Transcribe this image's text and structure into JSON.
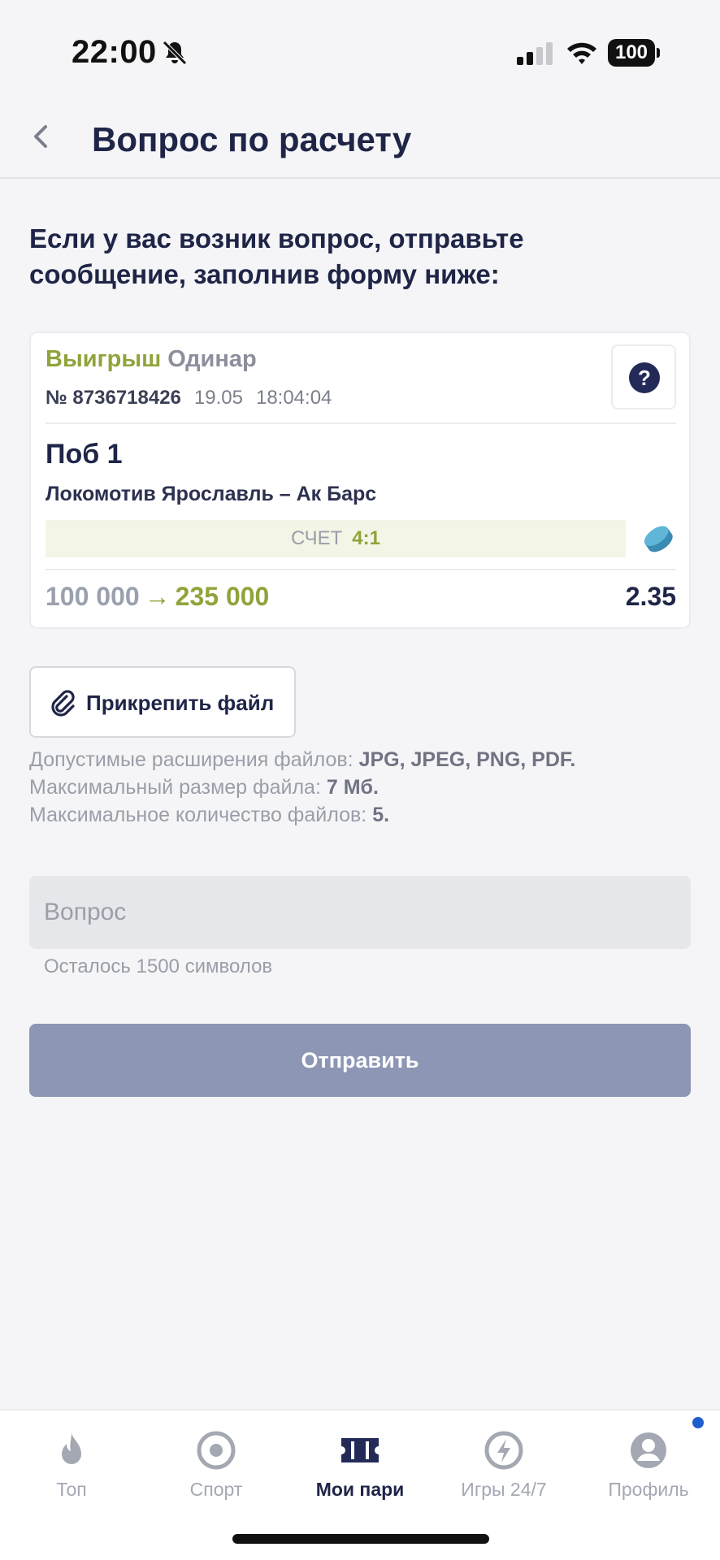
{
  "status_bar": {
    "time": "22:00",
    "battery": "100"
  },
  "header": {
    "title": "Вопрос по расчету"
  },
  "intro": "Если у вас возник вопрос, отправьте сообщение, заполнив форму ниже:",
  "bet": {
    "status": "Выигрыш",
    "type": "Одинар",
    "number": "№ 8736718426",
    "date": "19.05",
    "time": "18:04:04",
    "outcome": "Поб 1",
    "event": "Локомотив Ярославль – Ак Барс",
    "score_label": "СЧЕТ",
    "score_value": "4:1",
    "stake": "100 000",
    "arrow": "→",
    "payout": "235 000",
    "coefficient": "2.35",
    "help": "?"
  },
  "attach": {
    "label": "Прикрепить файл",
    "rule_ext_label": "Допустимые расширения файлов:",
    "rule_ext_value": "JPG, JPEG, PNG, PDF.",
    "rule_size_label": "Максимальный размер файла:",
    "rule_size_value": "7 Мб.",
    "rule_count_label": "Максимальное количество файлов:",
    "rule_count_value": "5."
  },
  "question": {
    "placeholder": "Вопрос",
    "chars_left": "Осталось 1500 символов"
  },
  "submit_label": "Отправить",
  "nav": [
    {
      "label": "Топ",
      "icon": "flame-icon"
    },
    {
      "label": "Спорт",
      "icon": "sport-icon"
    },
    {
      "label": "Мои пари",
      "icon": "ticket-icon",
      "active": true
    },
    {
      "label": "Игры 24/7",
      "icon": "lightning-icon"
    },
    {
      "label": "Профиль",
      "icon": "profile-icon"
    }
  ],
  "colors": {
    "accent_green": "#8fa43a",
    "navy": "#1f2547",
    "submit_disabled": "#8d97b5"
  }
}
